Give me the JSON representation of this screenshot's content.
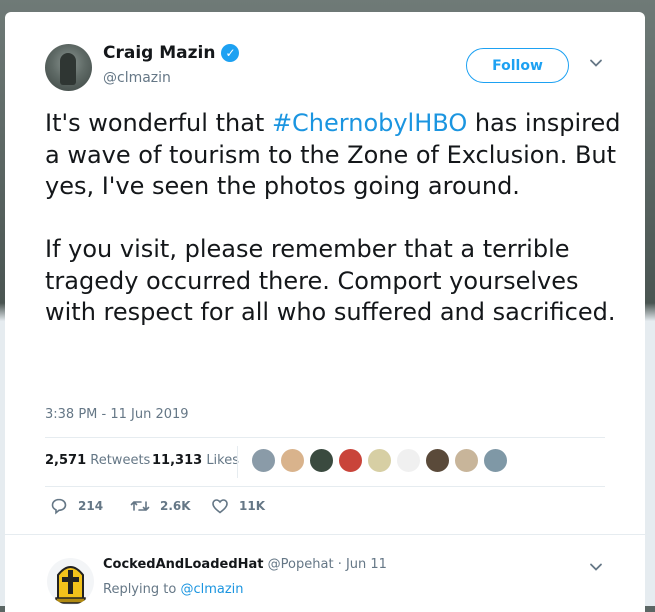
{
  "tweet": {
    "author_name": "Craig Mazin",
    "verified_icon": "verified-check-icon",
    "handle": "@clmazin",
    "follow_label": "Follow",
    "text_line1_before": "It's wonderful that ",
    "hashtag": "#ChernobylHBO",
    "text_line1_after": " has inspired a wave of tourism to the Zone of Exclusion. But yes, I've seen the photos going around.",
    "text_paragraph2": "If you visit, please remember that a terrible tragedy occurred there. Comport yourselves with respect for all who suffered and sacrificed.",
    "timestamp": "3:38 PM - 11 Jun 2019",
    "retweets_count": "2,571",
    "retweets_label": "Retweets",
    "likes_count": "11,313",
    "likes_label": "Likes",
    "liker_avatar_colors": [
      "#8a9ba8",
      "#d9b38c",
      "#3a4a3f",
      "#c9443a",
      "#d7cfa4",
      "#f0f0f0",
      "#5a4a3a",
      "#c8b59a",
      "#7f98a6"
    ],
    "reply_count": "214",
    "retweet_action_count": "2.6K",
    "like_action_count": "11K"
  },
  "reply": {
    "author_name": "CockedAndLoadedHat",
    "handle": "@Popehat",
    "separator": "·",
    "date": "Jun 11",
    "replying_to_label": "Replying to",
    "replying_to_handle": "@clmazin"
  },
  "colors": {
    "accent": "#1da1f2",
    "link": "#1b95e0",
    "text": "#14171a",
    "muted": "#657786"
  }
}
